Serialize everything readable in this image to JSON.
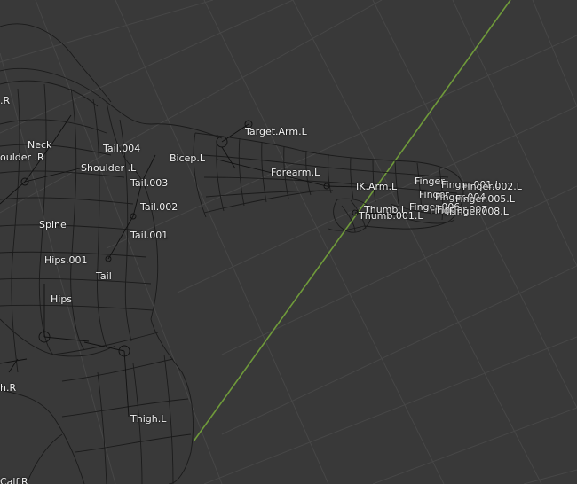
{
  "viewport": {
    "background": "#393939",
    "grid_color": "#474747",
    "grid_minor_color": "#404040",
    "axis_color": "#6f9a3a",
    "mesh_wire_color": "#1b1b1b",
    "bone_color": "#111111",
    "label_color": "#f2f2f2"
  },
  "bones": {
    "r_edge": ".R",
    "neck": "Neck",
    "shoulder_r": "oulder .R",
    "tail_004": "Tail.004",
    "shoulder_l": "Shoulder .L",
    "bicep_l": "Bicep.L",
    "target_arm_l": "Target.Arm.L",
    "forearm_l": "Forearm.L",
    "tail_003": "Tail.003",
    "tail_002": "Tail.002",
    "spine": "Spine",
    "tail_001": "Tail.001",
    "hips_001": "Hips.001",
    "tail": "Tail",
    "hips": "Hips",
    "ik_arm_l": "IK.Arm.L",
    "finger_001_l": "Finger.001.L",
    "finger_002_l": "Finger.002.L",
    "finger_004": "Finger.004",
    "finger_005_l": "Finger.005.L",
    "thumb_l": "Thumb.L",
    "thumb_001_l": "Thumb.001.L",
    "finger_006": "Finger.006",
    "finger_007": "Finger.007",
    "finger_008_l": "Finger.008.L",
    "finger_overlap_a": "Finger",
    "finger_overlap_b": "Finger",
    "finger_overlap_c": "Fing",
    "h_r": "h.R",
    "thigh_l": "Thigh.L",
    "calf_r": "Calf.R"
  }
}
